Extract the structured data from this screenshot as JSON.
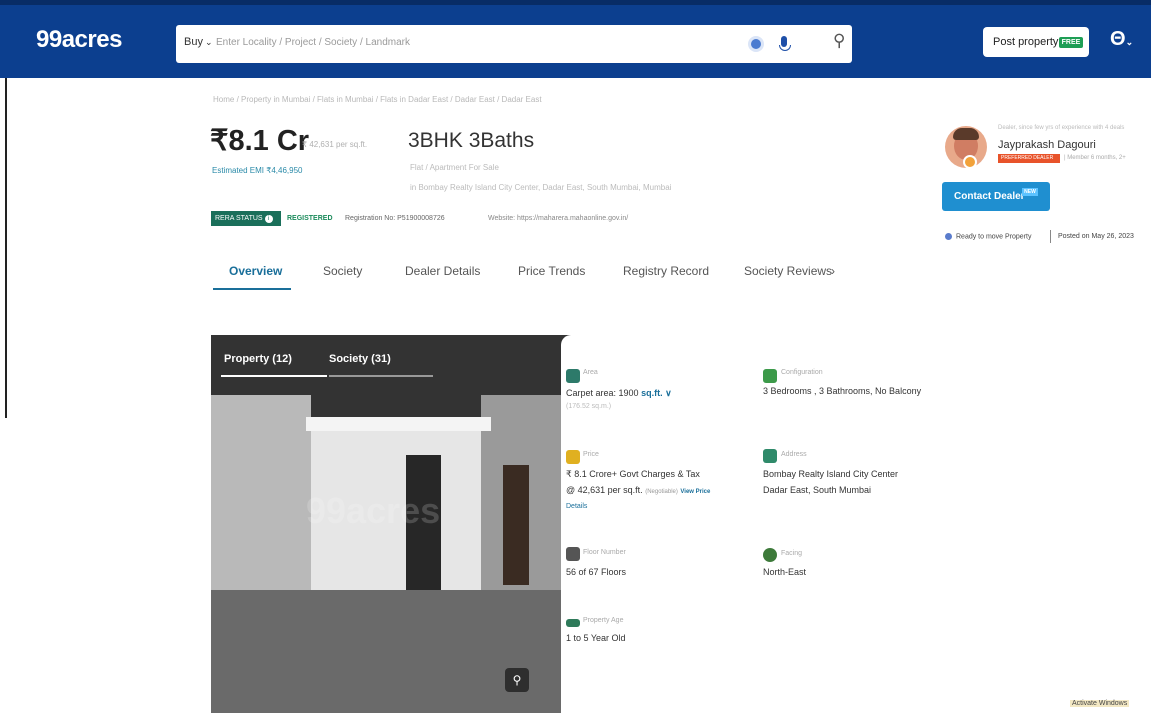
{
  "header": {
    "logo": "99acres",
    "buy_label": "Buy",
    "search_placeholder": "Enter Locality / Project / Society / Landmark",
    "post_property_label": "Post property",
    "free_badge": "FREE",
    "user_icon_glyph": "Θ"
  },
  "breadcrumb": "Home / Property in Mumbai / Flats in Mumbai / Flats in Dadar East / Dadar East / Dadar East",
  "listing": {
    "price": "₹8.1 Cr",
    "price_per_sqft": "₹ 42,631 per sq.ft.",
    "emi": "Estimated EMI ₹4,46,950",
    "title": "3BHK 3Baths",
    "subtitle": "Flat / Apartment For Sale",
    "location": "in Bombay Realty Island City Center, Dadar East, South Mumbai, Mumbai",
    "rera_status": "RERA STATUS",
    "rera_state": "REGISTERED",
    "registration": "Registration No: P51900008726",
    "website": "Website: https://maharera.mahaonline.gov.in/"
  },
  "tabs": [
    "Overview",
    "Society",
    "Dealer Details",
    "Price Trends",
    "Registry Record",
    "Society Reviews"
  ],
  "tabs_more": "›",
  "photos": {
    "tab_property": "Property (12)",
    "tab_society": "Society (31)",
    "watermark": "99acres",
    "zoom_glyph": "⚲"
  },
  "details": {
    "area": {
      "label": "Area",
      "value": "Carpet area: 1900",
      "unit": "sq.ft.",
      "chev": "∨",
      "note": "(176.52 sq.m.)"
    },
    "configuration": {
      "label": "Configuration",
      "value": "3 Bedrooms , 3 Bathrooms, No Balcony"
    },
    "price": {
      "label": "Price",
      "line1": "₹ 8.1 Crore+ Govt Charges & Tax",
      "line2": "@ 42,631 per sq.ft.",
      "negotiable": "(Negotiable)",
      "link1": "View Price",
      "link2": "Details"
    },
    "address": {
      "label": "Address",
      "line1": "Bombay Realty Island City Center",
      "line2": "Dadar East, South Mumbai"
    },
    "floor": {
      "label": "Floor Number",
      "value": "56  of 67 Floors"
    },
    "facing": {
      "label": "Facing",
      "value": "North-East"
    },
    "age": {
      "label": "Property Age",
      "value": "1 to 5 Year Old"
    }
  },
  "dealer": {
    "top_note": "Dealer, since few yrs of experience with 4 deals",
    "name": "Jayprakash Dagouri",
    "badge": "PREFERRED DEALER",
    "sub_note": "| Member 6 months, 2+",
    "contact_label": "Contact Dealer",
    "new_badge": "NEW",
    "ready": "Ready to move Property",
    "posted": "Posted on May 26, 2023"
  },
  "corner_note": "Activate Windows",
  "colors": {
    "brand_blue": "#0c3f8f",
    "link_teal": "#1a6f9a",
    "rera_green": "#1a6f5a",
    "cta_blue": "#1f8fd0"
  }
}
